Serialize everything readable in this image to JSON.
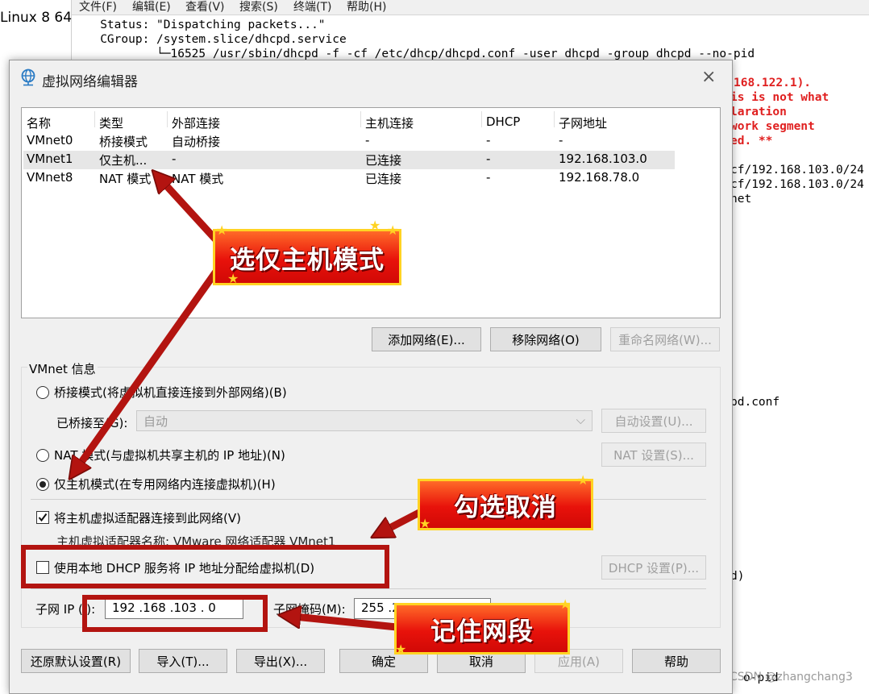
{
  "background": {
    "left_label": "Linux 8 64",
    "menu": [
      "文件(F)",
      "编辑(E)",
      "查看(V)",
      "搜索(S)",
      "终端(T)",
      "帮助(H)"
    ],
    "lines": [
      "   Status: \"Dispatching packets...\"",
      "   CGroup: /system.slice/dhcpd.service",
      "           └─16525 /usr/sbin/dhcpd -f -cf /etc/dhcp/dhcpd.conf -user dhcpd -group dhcpd --no-pid"
    ],
    "right_red": [
      "168.122.1).",
      "is is not what",
      "laration",
      "work segment",
      "ed. **"
    ],
    "right_plain": [
      "cf/192.168.103.0/24",
      "cf/192.168.103.0/24",
      "net",
      "pd.conf",
      "d)",
      "o-pid"
    ],
    "watermark": "CSDN @zhangchang3"
  },
  "dialog": {
    "title": "虚拟网络编辑器",
    "close": "×",
    "table": {
      "headers": [
        "名称",
        "类型",
        "外部连接",
        "主机连接",
        "DHCP",
        "子网地址"
      ],
      "rows": [
        [
          "VMnet0",
          "桥接模式",
          "自动桥接",
          "-",
          "-",
          "-"
        ],
        [
          "VMnet1",
          "仅主机...",
          "-",
          "已连接",
          "-",
          "192.168.103.0"
        ],
        [
          "VMnet8",
          "NAT 模式",
          "NAT 模式",
          "已连接",
          "-",
          "192.168.78.0"
        ]
      ]
    },
    "buttons": {
      "add": "添加网络(E)...",
      "remove": "移除网络(O)",
      "rename": "重命名网络(W)...",
      "auto_setting": "自动设置(U)...",
      "nat_setting": "NAT 设置(S)...",
      "dhcp_setting": "DHCP 设置(P)...",
      "restore": "还原默认设置(R)",
      "import": "导入(T)...",
      "export": "导出(X)...",
      "ok": "确定",
      "cancel": "取消",
      "apply": "应用(A)",
      "help": "帮助"
    },
    "vmnet_info": {
      "group_label": "VMnet 信息",
      "bridge": "桥接模式(将虚拟机直接连接到外部网络)(B)",
      "bridged_to_label": "已桥接至(G):",
      "bridged_to_value": "自动",
      "nat": "NAT 模式(与虚拟机共享主机的 IP 地址)(N)",
      "host_only": "仅主机模式(在专用网络内连接虚拟机)(H)",
      "connect_adapter": "将主机虚拟适配器连接到此网络(V)",
      "adapter_name": "主机虚拟适配器名称: VMware 网络适配器 VMnet1",
      "use_dhcp": "使用本地 DHCP 服务将 IP 地址分配给虚拟机(D)",
      "subnet_ip_label": "子网 IP (I):",
      "subnet_ip": "192 .168 .103 .  0",
      "subnet_mask_label": "子网掩码(M):",
      "subnet_mask": "255 .255 .255 .  0"
    }
  },
  "annotations": {
    "host_only": "选仅主机模式",
    "uncheck": "勾选取消",
    "remember": "记住网段"
  },
  "colors": {
    "accent_red": "#b31410",
    "callout_gold": "#ffd323"
  }
}
